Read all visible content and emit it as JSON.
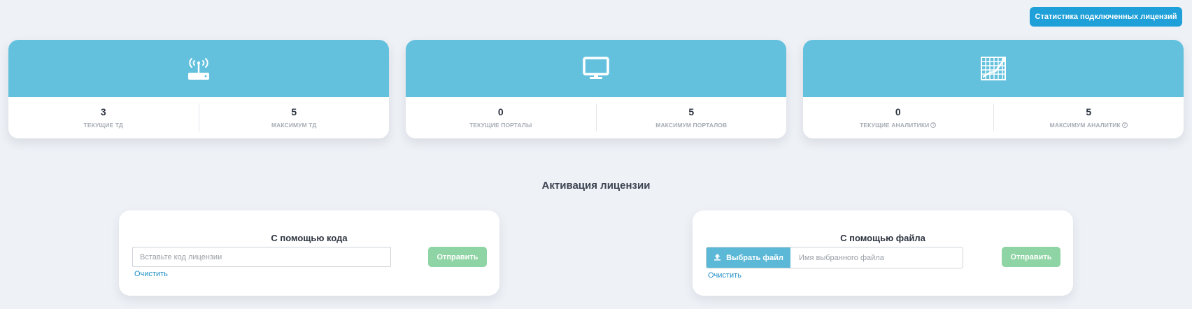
{
  "header": {
    "stats_button_label": "Статистика подключенных лицензий"
  },
  "cards": [
    {
      "icon": "router-icon",
      "current": {
        "value": "3",
        "label": "ТЕКУЩИЕ ТД"
      },
      "maximum": {
        "value": "5",
        "label": "МАКСИМУМ ТД"
      }
    },
    {
      "icon": "monitor-icon",
      "current": {
        "value": "0",
        "label": "ТЕКУЩИЕ ПОРТАЛЫ"
      },
      "maximum": {
        "value": "5",
        "label": "МАКСИМУМ ПОРТАЛОВ"
      }
    },
    {
      "icon": "analytics-chart-icon",
      "current": {
        "value": "0",
        "label": "ТЕКУЩИЕ АНАЛИТИКИ",
        "help_icon": "question-circle-icon"
      },
      "maximum": {
        "value": "5",
        "label": "МАКСИМУМ АНАЛИТИК",
        "help_icon": "question-circle-icon"
      }
    }
  ],
  "activation": {
    "title": "Активация лицензии",
    "by_code": {
      "title": "С помощью кода",
      "input_placeholder": "Вставьте код лицензии",
      "input_value": "",
      "clear_label": "Очистить",
      "send_label": "Отправить"
    },
    "by_file": {
      "title": "С помощью файла",
      "choose_label": "Выбрать файл",
      "choose_icon": "upload-icon",
      "file_placeholder": "Имя выбранного файла",
      "file_value": "",
      "clear_label": "Очистить",
      "send_label": "Отправить"
    }
  },
  "colors": {
    "page_bg": "#eef1f6",
    "card_header": "#64c1de",
    "primary_button": "#1fa0d8",
    "send_button": "#8fd4a4",
    "file_button": "#5bb8d6",
    "link": "#1f8fc7"
  }
}
